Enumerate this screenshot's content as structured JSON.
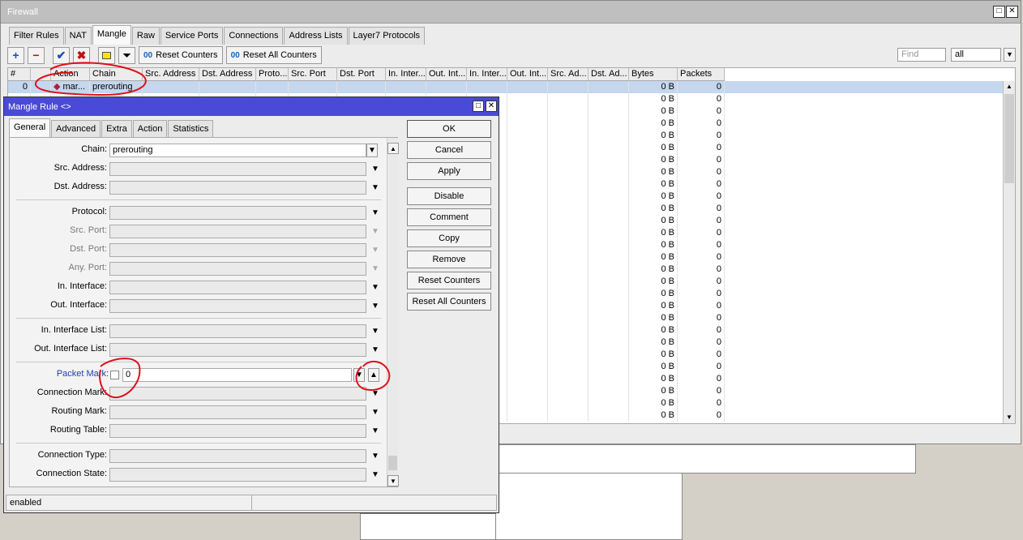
{
  "firewall": {
    "title": "Firewall",
    "tabs": [
      {
        "label": "Filter Rules"
      },
      {
        "label": "NAT"
      },
      {
        "label": "Mangle"
      },
      {
        "label": "Raw"
      },
      {
        "label": "Service Ports"
      },
      {
        "label": "Connections"
      },
      {
        "label": "Address Lists"
      },
      {
        "label": "Layer7 Protocols"
      }
    ],
    "active_tab": "Mangle",
    "toolbar": {
      "reset_counters": "Reset Counters",
      "reset_all_counters": "Reset All Counters",
      "find_placeholder": "Find",
      "filter_value": "all"
    },
    "columns": [
      "#",
      "",
      "Action",
      "Chain",
      "Src. Address",
      "Dst. Address",
      "Proto...",
      "Src. Port",
      "Dst. Port",
      "In. Inter...",
      "Out. Int...",
      "In. Inter...",
      "Out. Int...",
      "Src. Ad...",
      "Dst. Ad...",
      "Bytes",
      "Packets"
    ],
    "first_row": {
      "num": "0",
      "action": "mar...",
      "chain": "prerouting",
      "bytes": "0 B",
      "packets": "0"
    },
    "row_bytes": "0 B",
    "row_packets": "0"
  },
  "dialog": {
    "title": "Mangle Rule <>",
    "tabs": [
      {
        "label": "General"
      },
      {
        "label": "Advanced"
      },
      {
        "label": "Extra"
      },
      {
        "label": "Action"
      },
      {
        "label": "Statistics"
      }
    ],
    "fields": {
      "chain_label": "Chain:",
      "chain_value": "prerouting",
      "src_address": "Src. Address:",
      "dst_address": "Dst. Address:",
      "protocol": "Protocol:",
      "src_port": "Src. Port:",
      "dst_port": "Dst. Port:",
      "any_port": "Any. Port:",
      "in_interface": "In. Interface:",
      "out_interface": "Out. Interface:",
      "in_interface_list": "In. Interface List:",
      "out_interface_list": "Out. Interface List:",
      "packet_mark": "Packet Mark:",
      "packet_mark_value": "0",
      "connection_mark": "Connection Mark:",
      "routing_mark": "Routing Mark:",
      "routing_table": "Routing Table:",
      "connection_type": "Connection Type:",
      "connection_state": "Connection State:"
    },
    "buttons": {
      "ok": "OK",
      "cancel": "Cancel",
      "apply": "Apply",
      "disable": "Disable",
      "comment": "Comment",
      "copy": "Copy",
      "remove": "Remove",
      "reset_counters": "Reset Counters",
      "reset_all_counters": "Reset All Counters"
    },
    "status": "enabled"
  },
  "colors": {
    "dialog_title": "#4a4ad8",
    "selection": "#c4d7ef",
    "annotation": "#e0101a"
  }
}
